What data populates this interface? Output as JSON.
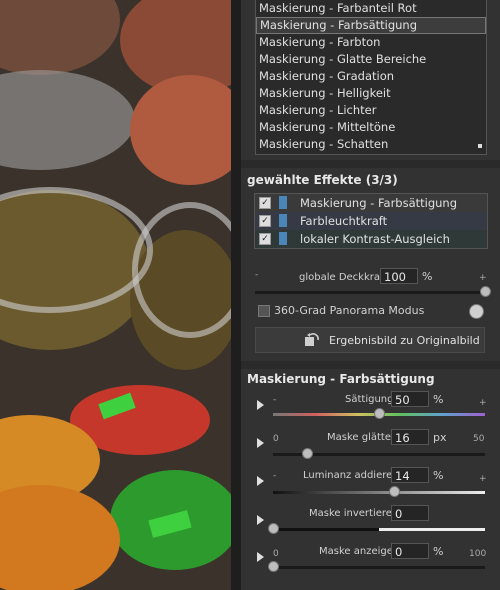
{
  "masks_list": {
    "items": [
      "Maskierung - Farbanteil Rot",
      "Maskierung - Farbsättigung",
      "Maskierung - Farbton",
      "Maskierung - Glatte Bereiche",
      "Maskierung - Gradation",
      "Maskierung - Helligkeit",
      "Maskierung - Lichter",
      "Maskierung - Mitteltöne",
      "Maskierung - Schatten"
    ],
    "selected_index": 1
  },
  "effects": {
    "title": "gewählte Effekte (3/3)",
    "items": [
      {
        "label": "Maskierung - Farbsättigung",
        "checked": true
      },
      {
        "label": "Farbleuchtkraft",
        "checked": true
      },
      {
        "label": "lokaler Kontrast-Ausgleich",
        "checked": true
      }
    ],
    "opacity": {
      "minus": "-",
      "label": "globale Deckkraft",
      "value": "100",
      "unit": "%",
      "plus": "+",
      "level": 100
    },
    "panorama_label": "360-Grad Panorama Modus",
    "result_button": "Ergebnisbild zu Originalbild"
  },
  "settings": {
    "title": "Maskierung - Farbsättigung",
    "saturation": {
      "minus": "-",
      "label": "Sättigung",
      "value": "50",
      "unit": "%",
      "plus": "+",
      "level": 50
    },
    "smooth": {
      "min": "0",
      "label": "Maske glätten",
      "value": "16",
      "unit": "px",
      "max": "50",
      "level": 16
    },
    "luminance": {
      "minus": "-",
      "label": "Luminanz addieren",
      "value": "14",
      "unit": "%",
      "plus": "+",
      "level": 57
    },
    "invert": {
      "label": "Maske invertieren",
      "value": "0",
      "level": 0
    },
    "show": {
      "min": "0",
      "label": "Maske anzeigen",
      "value": "0",
      "unit": "%",
      "max": "100",
      "level": 0
    }
  },
  "colors": {
    "accent": "#4a86b8",
    "panel": "#323232",
    "background": "#2b2b2b"
  }
}
